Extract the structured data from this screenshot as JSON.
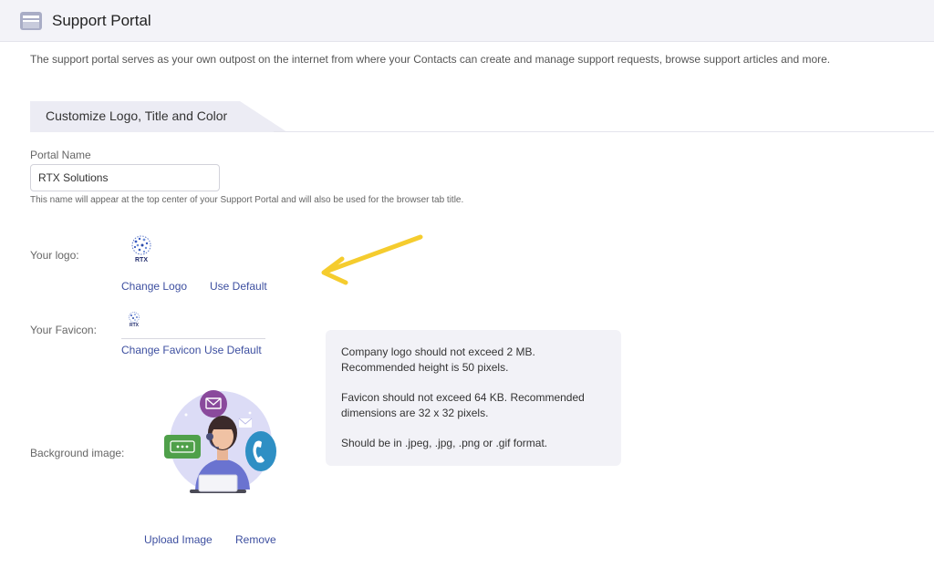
{
  "header": {
    "title": "Support Portal"
  },
  "description": "The support portal serves as your own outpost on the internet from where your Contacts can create and manage support requests, browse support articles and more.",
  "section": {
    "title": "Customize Logo, Title and Color"
  },
  "portal_name": {
    "label": "Portal Name",
    "value": "RTX Solutions",
    "hint": "This name will appear at the top center of your Support Portal and will also be used for the browser tab title."
  },
  "logo": {
    "label": "Your logo:",
    "logo_text": "RTX",
    "change_label": "Change Logo",
    "default_label": "Use Default"
  },
  "favicon": {
    "label": "Your Favicon:",
    "logo_text": "RTX",
    "change_label": "Change Favicon",
    "default_label": "Use Default"
  },
  "background": {
    "label": "Background image:",
    "upload_label": "Upload Image",
    "remove_label": "Remove"
  },
  "info": {
    "logo_note": "Company logo should not exceed 2 MB. Recommended height is 50 pixels.",
    "favicon_note": "Favicon should not exceed 64 KB. Recommended dimensions are 32 x 32 pixels.",
    "format_note": "Should be in .jpeg, .jpg, .png or .gif format."
  },
  "colors": {
    "accent": "#3d4fa0",
    "arrow": "#f5cc2e",
    "header_bg": "#f3f3f8"
  }
}
